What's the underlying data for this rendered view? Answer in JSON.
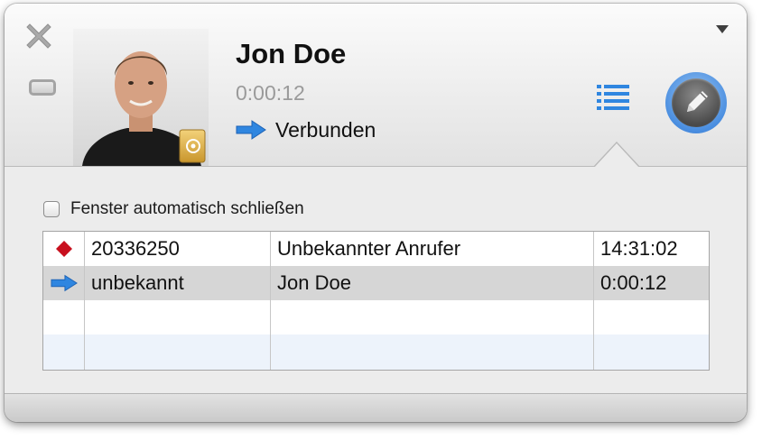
{
  "window": {
    "controls": {
      "close_icon": "close-x-icon",
      "minimize_icon": "minimize-icon",
      "menu_icon": "chevron-down-icon"
    }
  },
  "contact": {
    "name": "Jon Doe",
    "timer": "0:00:12",
    "status": "Verbunden",
    "status_icon": "outgoing-arrow-icon",
    "avatar_badge_icon": "address-book-icon"
  },
  "actions": {
    "list_icon": "list-icon",
    "edit_icon": "pencil-icon"
  },
  "options": {
    "auto_close_label": "Fenster automatisch schließen",
    "auto_close_checked": false
  },
  "calls": {
    "rows": [
      {
        "icon": "missed-call-diamond-icon",
        "number": "20336250",
        "name": "Unbekannter Anrufer",
        "time": "14:31:02"
      },
      {
        "icon": "outgoing-arrow-icon",
        "number": "unbekannt",
        "name": "Jon Doe",
        "time": "0:00:12"
      }
    ]
  },
  "colors": {
    "accent_blue": "#2f86e0",
    "missed_red": "#c8101e",
    "selected_row": "#d6d6d6",
    "alt_row": "#edf3fb"
  }
}
